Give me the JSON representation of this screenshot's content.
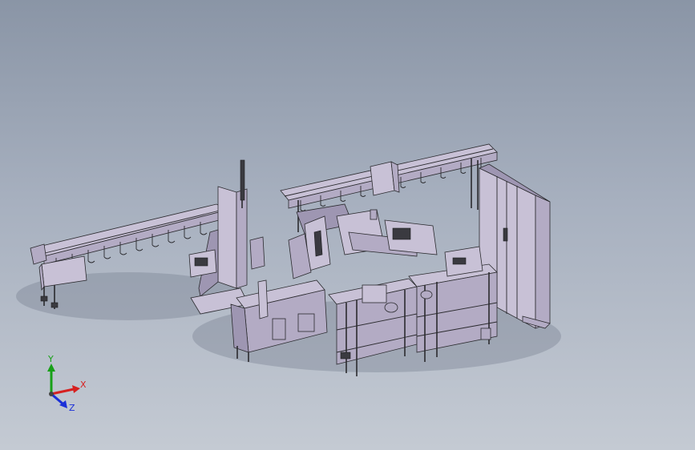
{
  "viewport": {
    "background_top": "#8a95a6",
    "background_bottom": "#c4cad3",
    "model_color": "#c8c1d6",
    "edge_color": "#2a2a2e"
  },
  "triad": {
    "x_label": "X",
    "y_label": "Y",
    "z_label": "Z",
    "x_color": "#d62020",
    "y_color": "#18a018",
    "z_color": "#1a2fd8"
  }
}
